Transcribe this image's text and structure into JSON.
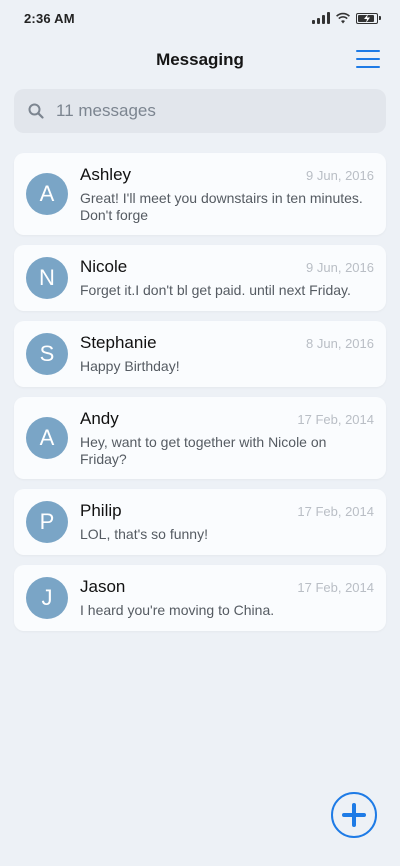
{
  "status_bar": {
    "time": "2:36 AM"
  },
  "header": {
    "title": "Messaging"
  },
  "search": {
    "placeholder": "11 messages"
  },
  "messages": [
    {
      "initial": "A",
      "name": "Ashley",
      "date": "9 Jun, 2016",
      "preview": "Great! I'll meet you downstairs in ten minutes. Don't forge"
    },
    {
      "initial": "N",
      "name": "Nicole",
      "date": "9 Jun, 2016",
      "preview": "Forget it.I don't bl get paid. until next Friday."
    },
    {
      "initial": "S",
      "name": "Stephanie",
      "date": "8 Jun, 2016",
      "preview": "Happy Birthday!"
    },
    {
      "initial": "A",
      "name": "Andy",
      "date": "17 Feb, 2014",
      "preview": "Hey, want to get together with Nicole on Friday?"
    },
    {
      "initial": "P",
      "name": "Philip",
      "date": "17 Feb, 2014",
      "preview": "LOL, that's so funny!"
    },
    {
      "initial": "J",
      "name": "Jason",
      "date": "17 Feb, 2014",
      "preview": "I heard you're moving to China."
    }
  ],
  "icons": {
    "search": "search-icon",
    "menu": "menu-icon",
    "compose": "plus-icon"
  },
  "colors": {
    "accent": "#1e7be6",
    "avatar": "#7aa5c6",
    "background": "#edf1f6"
  }
}
